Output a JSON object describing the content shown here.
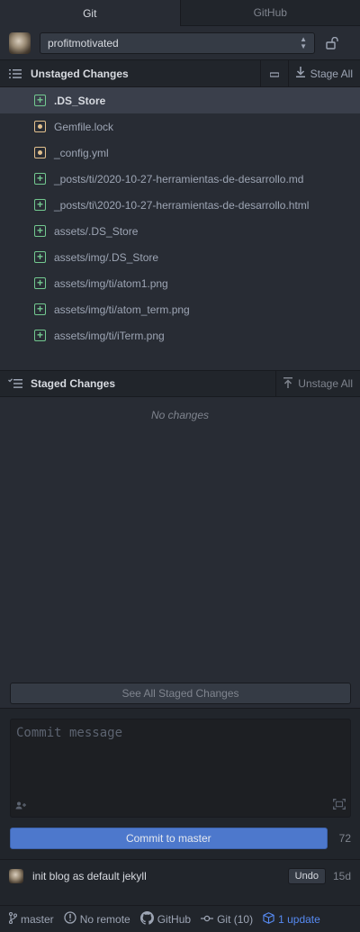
{
  "tabs": [
    {
      "label": "Git",
      "active": true
    },
    {
      "label": "GitHub",
      "active": false
    }
  ],
  "repo": {
    "name": "profitmotivated"
  },
  "unstaged": {
    "title": "Unstaged Changes",
    "stage_all_label": "Stage All",
    "files": [
      {
        "name": ".DS_Store",
        "status": "added",
        "selected": true
      },
      {
        "name": "Gemfile.lock",
        "status": "modified"
      },
      {
        "name": "_config.yml",
        "status": "modified"
      },
      {
        "name": "_posts/ti/2020-10-27-herramientas-de-desarrollo.md",
        "status": "added"
      },
      {
        "name": "_posts/ti\\2020-10-27-herramientas-de-desarrollo.html",
        "status": "added"
      },
      {
        "name": "assets/.DS_Store",
        "status": "added"
      },
      {
        "name": "assets/img/.DS_Store",
        "status": "added"
      },
      {
        "name": "assets/img/ti/atom1.png",
        "status": "added"
      },
      {
        "name": "assets/img/ti/atom_term.png",
        "status": "added"
      },
      {
        "name": "assets/img/ti/iTerm.png",
        "status": "added"
      }
    ]
  },
  "staged": {
    "title": "Staged Changes",
    "unstage_all_label": "Unstage All",
    "empty_label": "No changes",
    "see_all_label": "See All Staged Changes"
  },
  "commit": {
    "placeholder": "Commit message",
    "button_label": "Commit to master",
    "char_count": "72"
  },
  "recent_commit": {
    "message": "init blog as default jekyll",
    "undo_label": "Undo",
    "age": "15d"
  },
  "status_bar": {
    "branch": "master",
    "remote": "No remote",
    "github": "GitHub",
    "git": "Git (10)",
    "update": "1 update"
  },
  "colors": {
    "accent": "#4d78cc",
    "added": "#73c990",
    "modified": "#e2c08d",
    "update_link": "#568af2"
  },
  "icons": {
    "unstaged_header": "list-unordered-icon",
    "staged_header": "checklist-icon",
    "discard": "dash-icon",
    "stage_all": "move-down-icon",
    "unstage_all": "move-up-icon",
    "lock": "unlock-icon",
    "co_author": "person-add-icon",
    "expand": "screen-full-icon",
    "branch": "git-branch-icon",
    "remote": "no-remote-icon",
    "github": "mark-github-icon",
    "git": "git-commit-icon",
    "update": "package-icon"
  }
}
